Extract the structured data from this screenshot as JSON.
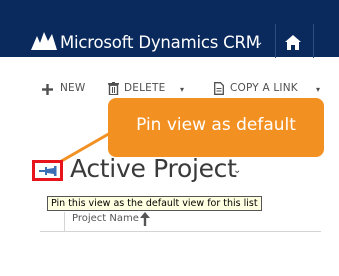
{
  "app": {
    "title": "Microsoft Dynamics CRM",
    "title_caret": "⌄",
    "logo_icon": "dynamics-logo-icon",
    "home_icon": "home-icon",
    "nav_color": "#0a2a5e"
  },
  "commands": {
    "new_label": "NEW",
    "delete_label": "DELETE",
    "copy_link_label": "COPY A LINK",
    "dropdown_glyph": "▾"
  },
  "callout": {
    "text": "Pin view as default",
    "color": "#f39022"
  },
  "view": {
    "title": "Active Project",
    "title_caret": "⌄",
    "pin_tooltip": "Pin this view as the default view for this list",
    "highlight_color": "#e8141c"
  },
  "grid": {
    "columns": [
      "Project Name"
    ]
  }
}
